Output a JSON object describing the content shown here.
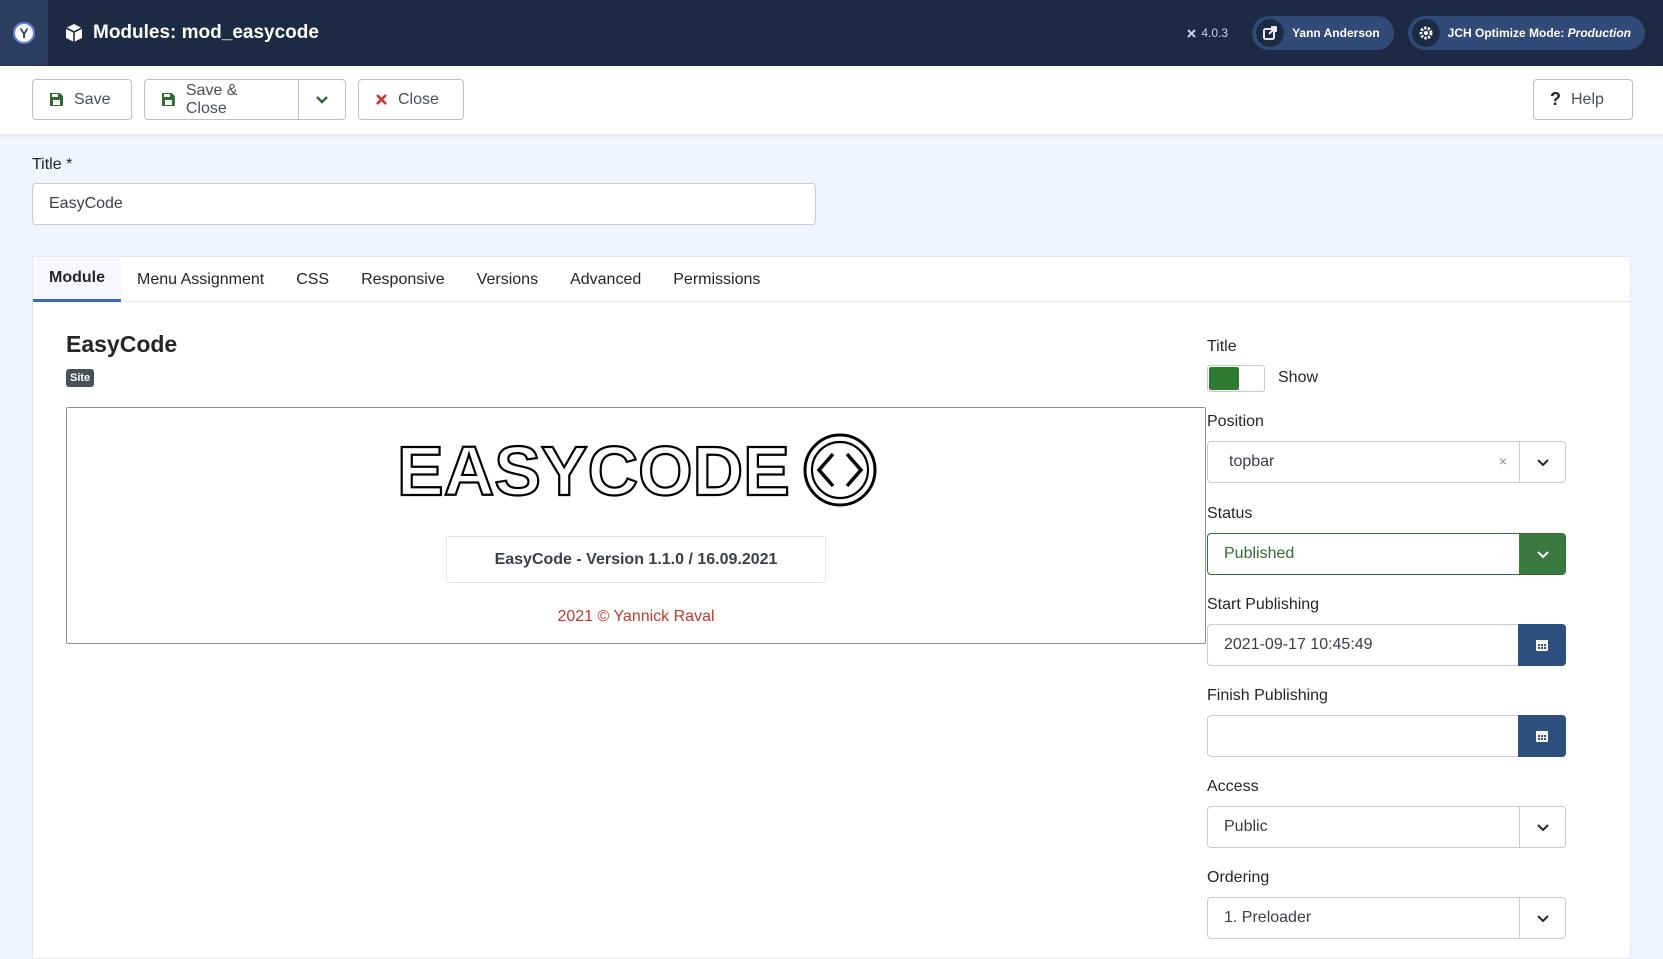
{
  "header": {
    "title": "Modules: mod_easycode",
    "version": "4.0.3",
    "user": "Yann Anderson",
    "optimize_prefix": "JCH Optimize Mode: ",
    "optimize_mode": "Production",
    "logo_letter": "Y"
  },
  "toolbar": {
    "save": "Save",
    "save_close": "Save & Close",
    "close": "Close",
    "help": "Help"
  },
  "form": {
    "title_label": "Title *",
    "title_value": "EasyCode"
  },
  "tabs": [
    "Module",
    "Menu Assignment",
    "CSS",
    "Responsive",
    "Versions",
    "Advanced",
    "Permissions"
  ],
  "module": {
    "name": "EasyCode",
    "badge": "Site",
    "logo_text": "EASYCODE",
    "version_text": "EasyCode - Version 1.1.0 / 16.09.2021",
    "copyright": "2021 © Yannick Raval"
  },
  "sidebar": {
    "title_label": "Title",
    "title_toggle": "Show",
    "position_label": "Position",
    "position_value": "topbar",
    "status_label": "Status",
    "status_value": "Published",
    "start_label": "Start Publishing",
    "start_value": "2021-09-17 10:45:49",
    "finish_label": "Finish Publishing",
    "finish_value": "",
    "access_label": "Access",
    "access_value": "Public",
    "ordering_label": "Ordering",
    "ordering_value": "1. Preloader"
  },
  "colors": {
    "header_bg": "#1c2a44",
    "status_green": "#3a7a40",
    "calendar_blue": "#2c4f80",
    "copyright_red": "#c0392b"
  }
}
